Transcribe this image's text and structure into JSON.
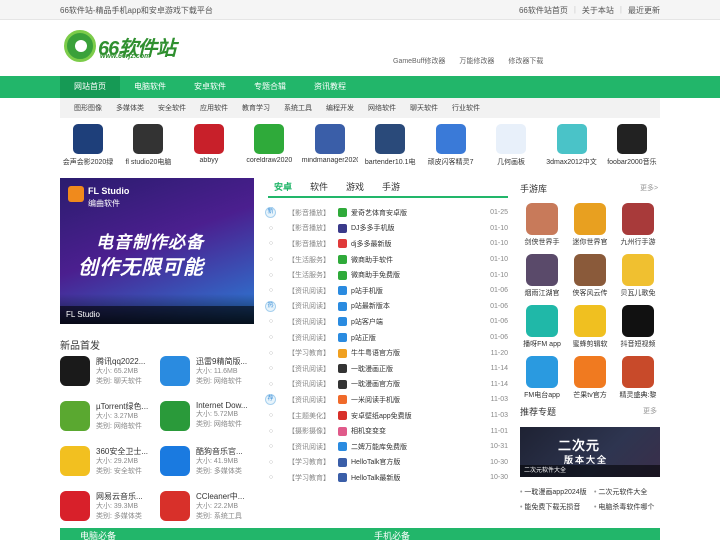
{
  "topbar": {
    "slogan": "66软件站-精品手机app和安卓游戏下载平台",
    "links": [
      "66软件站首页",
      "关于本站",
      "最近更新"
    ]
  },
  "header": {
    "brand": "66软件站",
    "url": "www.66rjz.com",
    "links": [
      "GameBuff修改器",
      "万能修改器",
      "修改器下载"
    ]
  },
  "nav": {
    "items": [
      "网站首页",
      "电脑软件",
      "安卓软件",
      "专题合辑",
      "资讯教程"
    ],
    "active": 0
  },
  "subnav": [
    "图形图像",
    "多媒体类",
    "安全软件",
    "应用软件",
    "教育学习",
    "系统工具",
    "编程开发",
    "网络软件",
    "聊天软件",
    "行业软件"
  ],
  "top_apps": [
    {
      "label": "会声会影2020绿",
      "color": "#1e3f7a"
    },
    {
      "label": "fl studio20电脑",
      "color": "#333333"
    },
    {
      "label": "abbyy",
      "color": "#c8202a"
    },
    {
      "label": "coreldraw2020",
      "color": "#2faa3a"
    },
    {
      "label": "mindmanager2020",
      "color": "#3a5ea8"
    },
    {
      "label": "bartender10.1电",
      "color": "#2a4a7a"
    },
    {
      "label": "顽皮闪客精灵7",
      "color": "#3a7ad8"
    },
    {
      "label": "几何画板",
      "color": "#e8f0fa"
    },
    {
      "label": "3dmax2012中文",
      "color": "#4ac3c8"
    },
    {
      "label": "foobar2000音乐",
      "color": "#222222"
    }
  ],
  "banner": {
    "title": "FL Studio",
    "subtitle": "编曲软件",
    "line1": "电音制作必备",
    "line2": "创作无限可能",
    "caption": "FL Studio"
  },
  "new_apps": {
    "title": "新品首发",
    "items": [
      {
        "name": "腾讯qq2022...",
        "size": "大小: 65.2MB",
        "type": "类别: 聊天软件",
        "color": "#1a1a1a"
      },
      {
        "name": "迅雷9精简版...",
        "size": "大小: 11.6MB",
        "type": "类别: 网络软件",
        "color": "#2a8be0"
      },
      {
        "name": "µTorrent绿色...",
        "size": "大小: 3.27MB",
        "type": "类别: 网络软件",
        "color": "#5aa830"
      },
      {
        "name": "Internet Dow...",
        "size": "大小: 5.72MB",
        "type": "类别: 网络软件",
        "color": "#2a9a3a"
      },
      {
        "name": "360安全卫士...",
        "size": "大小: 29.2MB",
        "type": "类别: 安全软件",
        "color": "#f2c020"
      },
      {
        "name": "酷狗音乐官...",
        "size": "大小: 41.9MB",
        "type": "类别: 多媒体类",
        "color": "#1a7ae0"
      },
      {
        "name": "网易云音乐...",
        "size": "大小: 39.3MB",
        "type": "类别: 多媒体类",
        "color": "#d8202a"
      },
      {
        "name": "CCleaner中...",
        "size": "大小: 22.2MB",
        "type": "类别: 系统工具",
        "color": "#d8302a"
      }
    ]
  },
  "tabs": [
    "安卓",
    "软件",
    "游戏",
    "手游"
  ],
  "list": [
    {
      "mark": "新",
      "cat": "【影音播放】",
      "name": "爱奇艺体育安卓版",
      "date": "01-25",
      "color": "#2faa3a"
    },
    {
      "mark": "",
      "cat": "【影音播放】",
      "name": "DJ多多手机版",
      "date": "01-10",
      "color": "#3a3a8a"
    },
    {
      "mark": "",
      "cat": "【影音播放】",
      "name": "dj多多最新版",
      "date": "01-10",
      "color": "#e03a3a"
    },
    {
      "mark": "",
      "cat": "【生活服务】",
      "name": "微商助手软件",
      "date": "01-10",
      "color": "#2faa3a"
    },
    {
      "mark": "",
      "cat": "【生活服务】",
      "name": "微商助手免费版",
      "date": "01-10",
      "color": "#2faa3a"
    },
    {
      "mark": "",
      "cat": "【资讯阅读】",
      "name": "p站手机版",
      "date": "01-06",
      "color": "#2a8be0"
    },
    {
      "mark": "热",
      "cat": "【资讯阅读】",
      "name": "p站最新版本",
      "date": "01-06",
      "color": "#2a8be0"
    },
    {
      "mark": "",
      "cat": "【资讯阅读】",
      "name": "p站客户端",
      "date": "01-06",
      "color": "#2a8be0"
    },
    {
      "mark": "",
      "cat": "【资讯阅读】",
      "name": "p站正版",
      "date": "01-06",
      "color": "#2a8be0"
    },
    {
      "mark": "",
      "cat": "【学习教育】",
      "name": "牛牛粤语官方版",
      "date": "11-20",
      "color": "#f0a020"
    },
    {
      "mark": "",
      "cat": "【资讯阅读】",
      "name": "一耽漫画正版",
      "date": "11-14",
      "color": "#333333"
    },
    {
      "mark": "",
      "cat": "【资讯阅读】",
      "name": "一耽漫画官方版",
      "date": "11-14",
      "color": "#333333"
    },
    {
      "mark": "荐",
      "cat": "【资讯阅读】",
      "name": "一米阅读手机版",
      "date": "11-03",
      "color": "#f06a2a"
    },
    {
      "mark": "",
      "cat": "【主题美化】",
      "name": "安卓壁纸app免费版",
      "date": "11-03",
      "color": "#d8302a"
    },
    {
      "mark": "",
      "cat": "【摄影摄像】",
      "name": "相机变变变",
      "date": "11-01",
      "color": "#e05a8a"
    },
    {
      "mark": "",
      "cat": "【资讯阅读】",
      "name": "二婢万能库免费版",
      "date": "10-31",
      "color": "#2a8be0"
    },
    {
      "mark": "",
      "cat": "【学习教育】",
      "name": "HelloTalk官方版",
      "date": "10-30",
      "color": "#3a5ea8"
    },
    {
      "mark": "",
      "cat": "【学习教育】",
      "name": "HelloTalk最新版",
      "date": "10-30",
      "color": "#3a5ea8"
    }
  ],
  "game_lib": {
    "title": "手游库",
    "more": "更多>",
    "items": [
      {
        "label": "剑侠世界手",
        "color": "#c87a5a"
      },
      {
        "label": "迷你世界官",
        "color": "#e8a020"
      },
      {
        "label": "九州行手游",
        "color": "#a83a3a"
      },
      {
        "label": "烟雨江湖官",
        "color": "#5a4a6a"
      },
      {
        "label": "侠客风云传",
        "color": "#8a5a3a"
      },
      {
        "label": "贝瓦儿歌免",
        "color": "#f0c030"
      },
      {
        "label": "播呀FM app",
        "color": "#20b8a8"
      },
      {
        "label": "蜜蜂剪辑软",
        "color": "#f0c020"
      },
      {
        "label": "抖音短视频",
        "color": "#111111"
      },
      {
        "label": "FM电台app",
        "color": "#2a9ae0"
      },
      {
        "label": "芒果tv官方",
        "color": "#f07a20"
      },
      {
        "label": "精灵盛典:黎",
        "color": "#c84a2a"
      }
    ]
  },
  "recommend": {
    "title": "推荐专题",
    "more": "更多",
    "img_t1": "二次元",
    "img_t2": "版本大全",
    "caption": "二次元软件大全",
    "links": [
      "一耽漫画app2024版",
      "二次元软件大全",
      "能免费下载无损音",
      "电脑杀毒软件哪个"
    ]
  },
  "bottom": [
    "电脑必备",
    "手机必备"
  ]
}
